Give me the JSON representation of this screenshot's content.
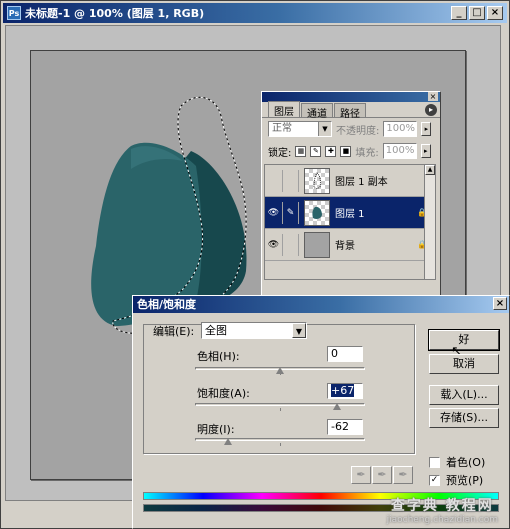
{
  "document": {
    "title": "未标题-1 @ 100% (图层 1, RGB)",
    "window_buttons": [
      "_",
      "□",
      "×"
    ]
  },
  "layers_panel": {
    "tabs": [
      "图层",
      "通道",
      "路径"
    ],
    "blend_mode": "正常",
    "opacity_label": "不透明度:",
    "opacity_value": "100%",
    "lock_label": "锁定:",
    "fill_label": "填充:",
    "fill_value": "100%",
    "layers": [
      {
        "name": "图层 1 副本",
        "visible": false,
        "selected": false
      },
      {
        "name": "图层 1",
        "visible": true,
        "selected": true
      },
      {
        "name": "背景",
        "visible": true,
        "selected": false
      }
    ]
  },
  "dialog": {
    "title": "色相/饱和度",
    "close": "×",
    "edit_label": "编辑(E):",
    "edit_value": "全图",
    "hue_label": "色相(H):",
    "hue_value": "0",
    "saturation_label": "饱和度(A):",
    "saturation_value": "+67",
    "lightness_label": "明度(I):",
    "lightness_value": "-62",
    "ok_label": "好",
    "cancel_label": "取消",
    "load_label": "载入(L)...",
    "save_label": "存储(S)...",
    "colorize_label": "着色(O)",
    "colorize_checked": false,
    "preview_label": "预览(P)",
    "preview_checked": true
  },
  "watermark": {
    "line1": "查字典 教程网",
    "line2": "jiaocheng.chazidian.com"
  },
  "colors": {
    "shape_fill": "#2a6469",
    "shape_shadow": "#17484d",
    "canvas_gray": "#a3a3a3",
    "selection_blue": "#0a246a"
  }
}
